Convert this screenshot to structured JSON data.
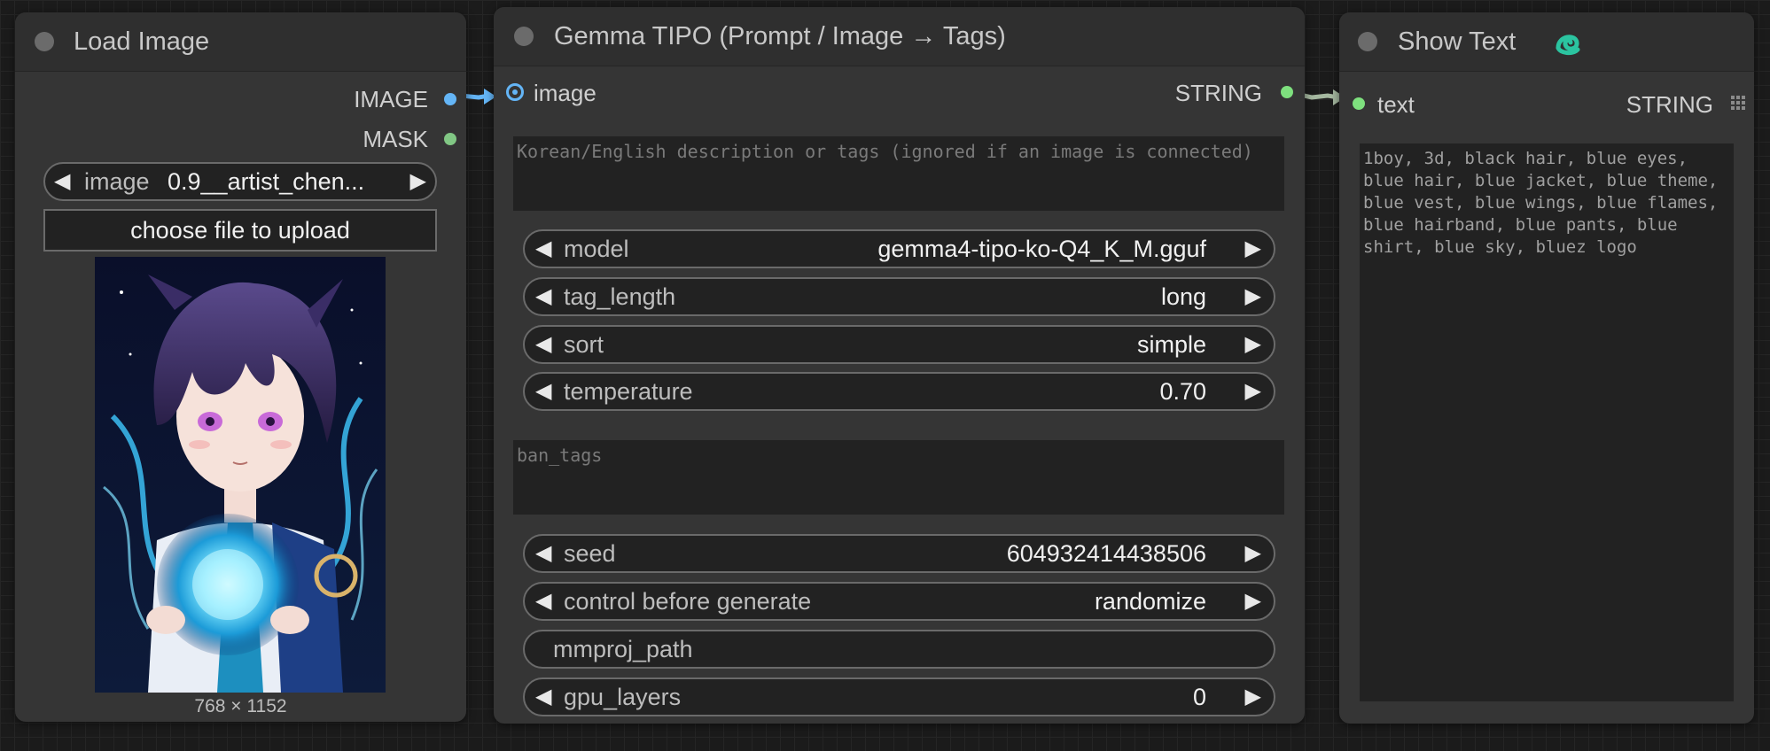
{
  "load_image": {
    "title": "Load Image",
    "outputs": [
      {
        "label": "IMAGE",
        "color": "#64b5f6"
      },
      {
        "label": "MASK",
        "color": "#81c784"
      }
    ],
    "image_widget": {
      "label": "image",
      "value": "0.9__artist_chen..."
    },
    "upload_label": "choose file to upload",
    "dimensions": "768 × 1152"
  },
  "gemma": {
    "title": "Gemma TIPO (Prompt / Image → Tags)",
    "input": {
      "label": "image",
      "color": "#64b5f6"
    },
    "output": {
      "label": "STRING",
      "color": "#7ee07e"
    },
    "prompt_placeholder": "Korean/English description or tags (ignored if an image is connected)",
    "widgets_a": [
      {
        "label": "model",
        "value": "gemma4-tipo-ko-Q4_K_M.gguf"
      },
      {
        "label": "tag_length",
        "value": "long"
      },
      {
        "label": "sort",
        "value": "simple"
      },
      {
        "label": "temperature",
        "value": "0.70"
      }
    ],
    "ban_tags_placeholder": "ban_tags",
    "widgets_b": [
      {
        "label": "seed",
        "value": "604932414438506"
      },
      {
        "label": "control before generate",
        "value": "randomize"
      }
    ],
    "mmproj_label": "mmproj_path",
    "gpu_layers": {
      "label": "gpu_layers",
      "value": "0"
    }
  },
  "show_text": {
    "title": "Show Text",
    "input": {
      "label": "text",
      "color": "#7ee07e"
    },
    "output": {
      "label": "STRING"
    },
    "content": "1boy, 3d, black hair, blue eyes, blue hair, blue jacket, blue theme, blue vest, blue wings, blue flames, blue hairband, blue pants, blue shirt, blue sky, bluez logo"
  },
  "colors": {
    "image_link": "#64b5f6",
    "string_link": "#a5b8a0",
    "snake_icon": "#2bc4a0"
  }
}
